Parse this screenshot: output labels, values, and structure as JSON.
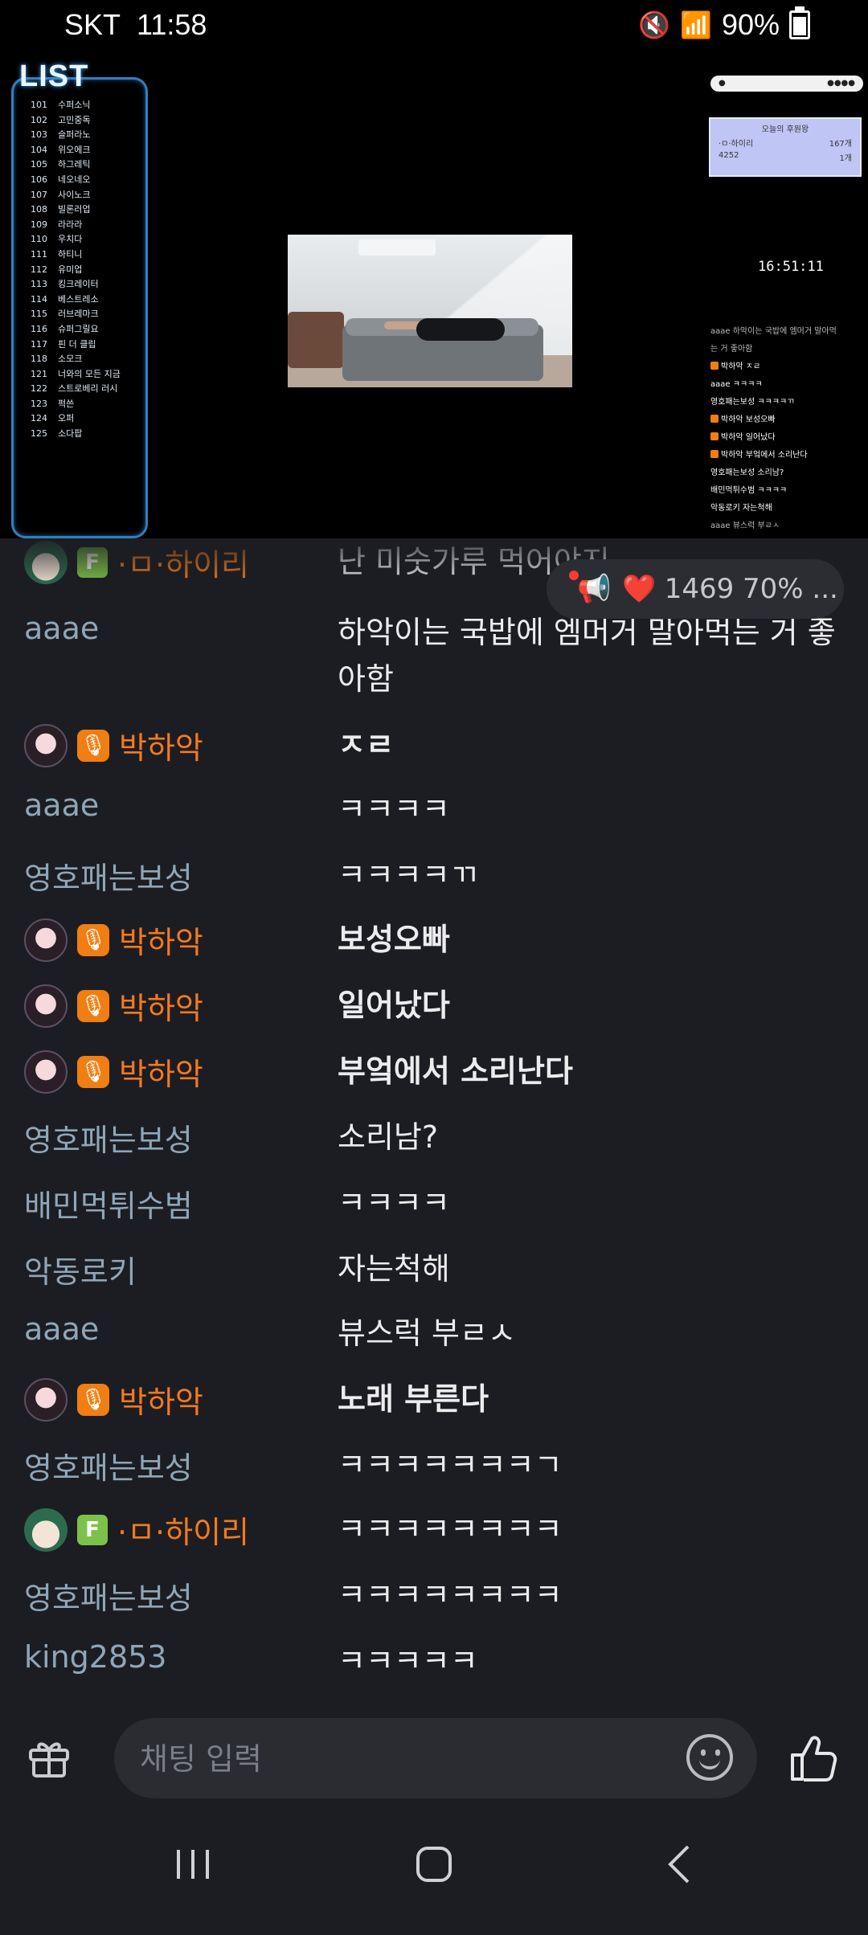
{
  "status_bar": {
    "carrier": "SKT",
    "time": "11:58",
    "battery": "90%"
  },
  "video": {
    "list_title": "LIST",
    "list_items": [
      {
        "n": "101",
        "t": "수퍼소닉"
      },
      {
        "n": "102",
        "t": "고민중독"
      },
      {
        "n": "103",
        "t": "슬퍼라노"
      },
      {
        "n": "104",
        "t": "위오에크"
      },
      {
        "n": "105",
        "t": "하그레틱"
      },
      {
        "n": "106",
        "t": "네오네오"
      },
      {
        "n": "107",
        "t": "사이노크"
      },
      {
        "n": "108",
        "t": "빌론러업"
      },
      {
        "n": "109",
        "t": "라라라"
      },
      {
        "n": "110",
        "t": "우치다"
      },
      {
        "n": "111",
        "t": "하티니"
      },
      {
        "n": "112",
        "t": "유미업"
      },
      {
        "n": "113",
        "t": "킹크레이터"
      },
      {
        "n": "114",
        "t": "베스트레소"
      },
      {
        "n": "115",
        "t": "러브레마크"
      },
      {
        "n": "116",
        "t": "슈퍼그릴요"
      },
      {
        "n": "117",
        "t": "핀 더 클립"
      },
      {
        "n": "118",
        "t": "소모크"
      },
      {
        "n": "121",
        "t": "너와의 모든 지금"
      },
      {
        "n": "122",
        "t": "스트로베리 러시"
      },
      {
        "n": "123",
        "t": "퍽쓴"
      },
      {
        "n": "124",
        "t": "오퍼"
      },
      {
        "n": "125",
        "t": "소다팝"
      }
    ],
    "clock": "16:51:11",
    "rank_title": "오늘의 후원왕",
    "rank_rows": [
      {
        "name": "·ㅁ·하이리",
        "value": "167개"
      },
      {
        "name": "4252",
        "value": "1개"
      }
    ],
    "mini_chat": [
      {
        "text": "aaae 하악이는 국밥에 엠머거 말아먹",
        "accent": false,
        "dim": true
      },
      {
        "text": "는 거 좋아함",
        "accent": false,
        "dim": true
      },
      {
        "text": "박하악 ㅈㄹ",
        "accent": true,
        "dim": false
      },
      {
        "text": "aaae ㅋㅋㅋㅋ",
        "accent": false,
        "dim": false
      },
      {
        "text": "영호패는보성 ㅋㅋㅋㅋㄲ",
        "accent": false,
        "dim": false
      },
      {
        "text": "박하악 보성오빠",
        "accent": true,
        "dim": false
      },
      {
        "text": "박하악 일어났다",
        "accent": true,
        "dim": false
      },
      {
        "text": "박하악 부엌에서 소리난다",
        "accent": true,
        "dim": false
      },
      {
        "text": "영호패는보성 소리남?",
        "accent": false,
        "dim": false
      },
      {
        "text": "배민먹튀수범 ㅋㅋㅋㅋ",
        "accent": false,
        "dim": false
      },
      {
        "text": "악동로키 자는척해",
        "accent": false,
        "dim": false
      },
      {
        "text": "aaae 뷰스럭 부ㄹㅅ",
        "accent": false,
        "dim": true
      }
    ]
  },
  "floating_pill": {
    "count": "1469",
    "percent": "70% ..."
  },
  "chat": {
    "messages": [
      {
        "user": "·ㅁ·하이리",
        "text": "난 미숫가루 먹어야지",
        "style": "orange",
        "badge": "fan",
        "bold": false
      },
      {
        "user": "aaae",
        "text": "하악이는 국밥에 엠머거 말아먹는 거 좋아함",
        "style": "gray",
        "badge": "none",
        "bold": false
      },
      {
        "user": "박하악",
        "text": "ㅈㄹ",
        "style": "orange",
        "badge": "host",
        "bold": true
      },
      {
        "user": "aaae",
        "text": "ㅋㅋㅋㅋ",
        "style": "gray",
        "badge": "none",
        "bold": false
      },
      {
        "user": "영호패는보성",
        "text": "ㅋㅋㅋㅋㄲ",
        "style": "gray",
        "badge": "none",
        "bold": false
      },
      {
        "user": "박하악",
        "text": "보성오빠",
        "style": "orange",
        "badge": "host",
        "bold": true
      },
      {
        "user": "박하악",
        "text": "일어났다",
        "style": "orange",
        "badge": "host",
        "bold": true
      },
      {
        "user": "박하악",
        "text": "부엌에서 소리난다",
        "style": "orange",
        "badge": "host",
        "bold": true
      },
      {
        "user": "영호패는보성",
        "text": "소리남?",
        "style": "gray",
        "badge": "none",
        "bold": false
      },
      {
        "user": "배민먹튀수범",
        "text": "ㅋㅋㅋㅋ",
        "style": "gray",
        "badge": "none",
        "bold": false
      },
      {
        "user": "악동로키",
        "text": "자는척해",
        "style": "gray",
        "badge": "none",
        "bold": false
      },
      {
        "user": "aaae",
        "text": "뷰스럭 부ㄹㅅ",
        "style": "gray",
        "badge": "none",
        "bold": false
      },
      {
        "user": "박하악",
        "text": "노래 부른다",
        "style": "orange",
        "badge": "host",
        "bold": true
      },
      {
        "user": "영호패는보성",
        "text": "ㅋㅋㅋㅋㅋㅋㅋㄱ",
        "style": "gray",
        "badge": "none",
        "bold": false
      },
      {
        "user": "·ㅁ·하이리",
        "text": "ㅋㅋㅋㅋㅋㅋㅋㅋ",
        "style": "orange",
        "badge": "fan",
        "bold": false
      },
      {
        "user": "영호패는보성",
        "text": "ㅋㅋㅋㅋㅋㅋㅋㅋ",
        "style": "gray",
        "badge": "none",
        "bold": false
      },
      {
        "user": "king2853",
        "text": "ㅋㅋㅋㅋㅋ",
        "style": "gray",
        "badge": "none",
        "bold": false
      }
    ]
  },
  "input": {
    "placeholder": "채팅 입력",
    "value": ""
  },
  "badges": {
    "fan_letter": "F",
    "mic_glyph": "🎙"
  },
  "colors": {
    "accent_orange": "#f47a1f",
    "user_gray": "#8fa6b8",
    "background": "#1c1d22"
  },
  "icons": {
    "gift": "gift-icon",
    "emoji": "smile-icon",
    "like": "thumbs-up-icon",
    "megaphone": "megaphone-icon",
    "heart": "heart-icon"
  }
}
